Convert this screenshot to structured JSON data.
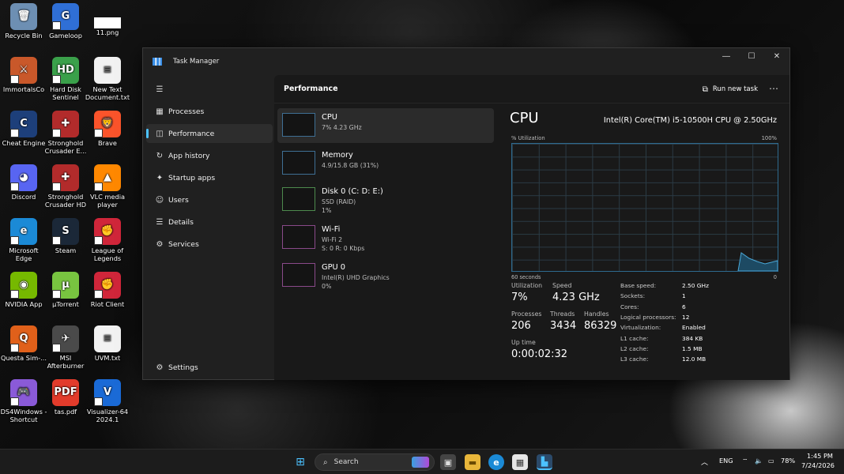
{
  "desktop": {
    "icons": [
      {
        "label": "Recycle Bin",
        "icon": "recycle-bin-icon",
        "color": "#6d8fb3",
        "glyph": "🗑"
      },
      {
        "label": "Gameloop",
        "icon": "gameloop-icon",
        "color": "#2f6fd6",
        "glyph": "G"
      },
      {
        "label": "11.png",
        "icon": "image-file-icon",
        "color": "#ffffff",
        "glyph": ""
      },
      {
        "label": "ImmortalsCo",
        "icon": "immortals-icon",
        "color": "#c9582a",
        "glyph": "⚔"
      },
      {
        "label": "Hard Disk Sentinel",
        "icon": "hard-disk-sentinel-icon",
        "color": "#3aa04a",
        "glyph": "HD"
      },
      {
        "label": "New Text Document.txt",
        "icon": "text-file-icon",
        "color": "#f2f2f2",
        "glyph": "≡"
      },
      {
        "label": "Cheat Engine",
        "icon": "cheat-engine-icon",
        "color": "#1d3f7a",
        "glyph": "C"
      },
      {
        "label": "Stronghold Crusader E...",
        "icon": "stronghold-icon",
        "color": "#b22b2b",
        "glyph": "✚"
      },
      {
        "label": "Brave",
        "icon": "brave-icon",
        "color": "#fb542b",
        "glyph": "🦁"
      },
      {
        "label": "Discord",
        "icon": "discord-icon",
        "color": "#5865f2",
        "glyph": "◕"
      },
      {
        "label": "Stronghold Crusader HD",
        "icon": "stronghold-hd-icon",
        "color": "#b22b2b",
        "glyph": "✚"
      },
      {
        "label": "VLC media player",
        "icon": "vlc-icon",
        "color": "#ff8800",
        "glyph": "▲"
      },
      {
        "label": "Microsoft Edge",
        "icon": "edge-icon",
        "color": "#1b8ad6",
        "glyph": "e"
      },
      {
        "label": "Steam",
        "icon": "steam-icon",
        "color": "#1b2838",
        "glyph": "S"
      },
      {
        "label": "League of Legends",
        "icon": "league-icon",
        "color": "#d0263a",
        "glyph": "✊"
      },
      {
        "label": "NVIDIA App",
        "icon": "nvidia-icon",
        "color": "#76b900",
        "glyph": "◉"
      },
      {
        "label": "µTorrent",
        "icon": "utorrent-icon",
        "color": "#78c440",
        "glyph": "µ"
      },
      {
        "label": "Riot Client",
        "icon": "riot-client-icon",
        "color": "#d0263a",
        "glyph": "✊"
      },
      {
        "label": "Questa Sim-...",
        "icon": "questa-icon",
        "color": "#e0601a",
        "glyph": "Q"
      },
      {
        "label": "MSI Afterburner",
        "icon": "msi-afterburner-icon",
        "color": "#4a4a4a",
        "glyph": "✈"
      },
      {
        "label": "UVM.txt",
        "icon": "text-file-icon",
        "color": "#f2f2f2",
        "glyph": "≡"
      },
      {
        "label": "DS4Windows - Shortcut",
        "icon": "ds4windows-icon",
        "color": "#8a5ad8",
        "glyph": "🎮"
      },
      {
        "label": "tas.pdf",
        "icon": "pdf-icon",
        "color": "#e23b2b",
        "glyph": "PDF"
      },
      {
        "label": "Visualizer-64 2024.1",
        "icon": "visualizer-icon",
        "color": "#1a6ad6",
        "glyph": "V"
      }
    ]
  },
  "taskmanager": {
    "title": "Task Manager",
    "nav": [
      {
        "label": "Processes",
        "icon": "processes-icon",
        "glyph": "▦"
      },
      {
        "label": "Performance",
        "icon": "performance-icon",
        "glyph": "◫"
      },
      {
        "label": "App history",
        "icon": "app-history-icon",
        "glyph": "↻"
      },
      {
        "label": "Startup apps",
        "icon": "startup-apps-icon",
        "glyph": "✦"
      },
      {
        "label": "Users",
        "icon": "users-icon",
        "glyph": "☺"
      },
      {
        "label": "Details",
        "icon": "details-icon",
        "glyph": "☰"
      },
      {
        "label": "Services",
        "icon": "services-icon",
        "glyph": "⚙"
      }
    ],
    "settings_label": "Settings",
    "section_title": "Performance",
    "run_new_task": "Run new task",
    "devices": [
      {
        "name": "CPU",
        "line1": "7% 4.23 GHz",
        "line2": ""
      },
      {
        "name": "Memory",
        "line1": "4.9/15.8 GB (31%)",
        "line2": ""
      },
      {
        "name": "Disk 0 (C: D: E:)",
        "line1": "SSD (RAID)",
        "line2": "1%"
      },
      {
        "name": "Wi-Fi",
        "line1": "Wi-Fi 2",
        "line2": "S: 0 R: 0 Kbps"
      },
      {
        "name": "GPU 0",
        "line1": "Intel(R) UHD Graphics",
        "line2": "0%"
      }
    ],
    "detail": {
      "title": "CPU",
      "model": "Intel(R) Core(TM) i5-10500H CPU @ 2.50GHz",
      "util_label": "% Utilization",
      "util_max": "100%",
      "time_left": "60 seconds",
      "time_right": "0",
      "utilization_label": "Utilization",
      "utilization": "7%",
      "speed_label": "Speed",
      "speed": "4.23 GHz",
      "processes_label": "Processes",
      "processes": "206",
      "threads_label": "Threads",
      "threads": "3434",
      "handles_label": "Handles",
      "handles": "86329",
      "uptime_label": "Up time",
      "uptime": "0:00:02:32",
      "specs": [
        {
          "k": "Base speed:",
          "v": "2.50 GHz"
        },
        {
          "k": "Sockets:",
          "v": "1"
        },
        {
          "k": "Cores:",
          "v": "6"
        },
        {
          "k": "Logical processors:",
          "v": "12"
        },
        {
          "k": "Virtualization:",
          "v": "Enabled"
        },
        {
          "k": "L1 cache:",
          "v": "384 KB"
        },
        {
          "k": "L2 cache:",
          "v": "1.5 MB"
        },
        {
          "k": "L3 cache:",
          "v": "12.0 MB"
        }
      ]
    }
  },
  "taskbar": {
    "search_placeholder": "Search",
    "lang": "ENG",
    "battery": "78%",
    "time": "1:45 PM",
    "date": "7/24/2026",
    "accent": "#4cc2ff"
  }
}
